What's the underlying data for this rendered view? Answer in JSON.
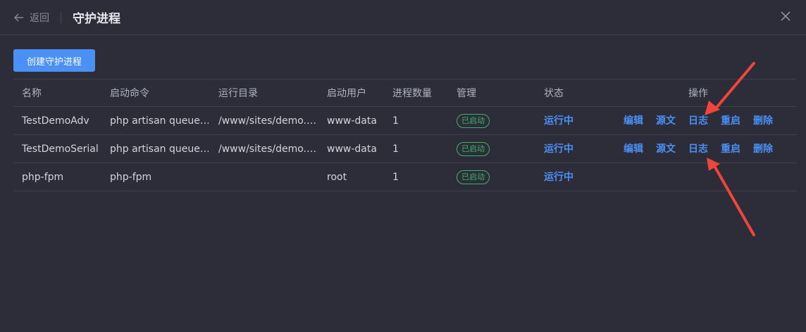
{
  "header": {
    "back_label": "返回",
    "title": "守护进程"
  },
  "toolbar": {
    "create_label": "创建守护进程"
  },
  "table": {
    "columns": [
      "名称",
      "启动命令",
      "运行目录",
      "启动用户",
      "进程数量",
      "管理",
      "状态",
      "操作"
    ],
    "rows": [
      {
        "name": "TestDemoAdv",
        "command": "php artisan queue…",
        "directory": "/www/sites/demo.…",
        "user": "www-data",
        "count": "1",
        "manage": "已启动",
        "status": "运行中",
        "ops": [
          "编辑",
          "源文",
          "日志",
          "重启",
          "删除"
        ]
      },
      {
        "name": "TestDemoSerial",
        "command": "php artisan queue…",
        "directory": "/www/sites/demo.…",
        "user": "www-data",
        "count": "1",
        "manage": "已启动",
        "status": "运行中",
        "ops": [
          "编辑",
          "源文",
          "日志",
          "重启",
          "删除"
        ]
      },
      {
        "name": "php-fpm",
        "command": "php-fpm",
        "directory": "",
        "user": "root",
        "count": "1",
        "manage": "已启动",
        "status": "运行中",
        "ops": []
      }
    ]
  },
  "colors": {
    "background": "#2c2d39",
    "accent": "#4a90f5",
    "success": "#3fb26a",
    "annotation": "#f0453a"
  }
}
